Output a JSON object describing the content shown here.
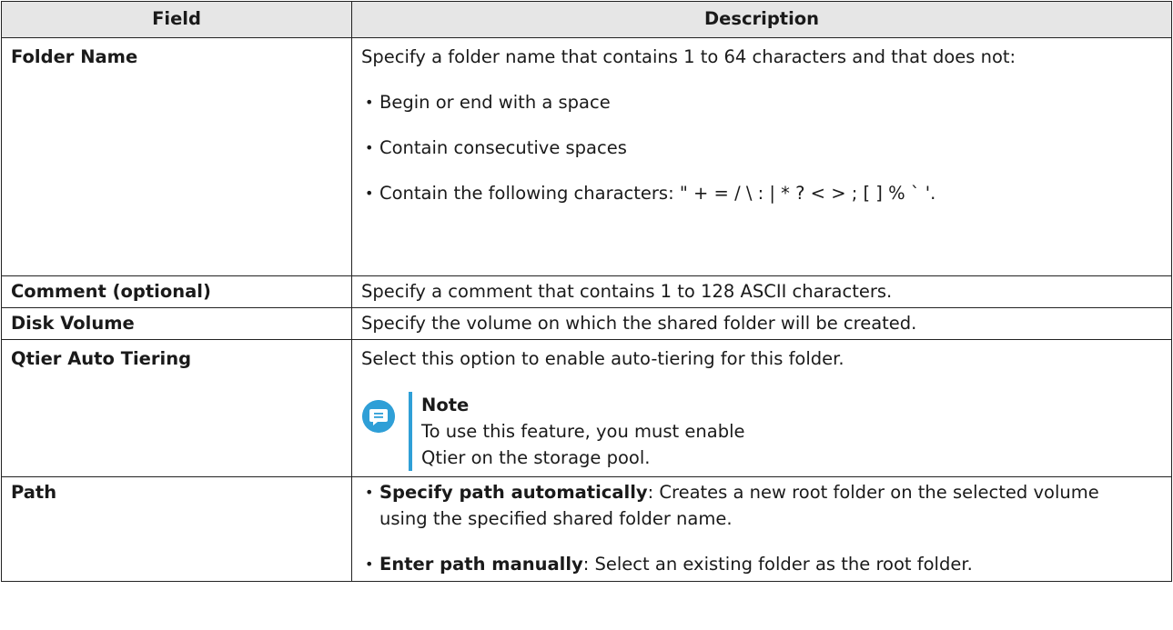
{
  "header": {
    "field": "Field",
    "description": "Description"
  },
  "rows": {
    "folder_name": {
      "field": "Folder Name",
      "intro": "Specify a folder name that contains 1 to 64 characters and that does not:",
      "bullets": [
        "Begin or end with a space",
        "Contain consecutive spaces",
        "Contain the following characters: \" + = / \\ : | * ? < > ; [ ] % ` '."
      ]
    },
    "comment": {
      "field": "Comment (optional)",
      "description": "Specify a comment that contains 1 to 128 ASCII characters."
    },
    "disk_volume": {
      "field": "Disk Volume",
      "description": "Specify the volume on which the shared folder will be created."
    },
    "qtier": {
      "field": "Qtier Auto Tiering",
      "description": "Select this option to enable auto-tiering for this folder.",
      "note_title": "Note",
      "note_body": "To use this feature, you must enable Qtier on the storage pool.",
      "note_icon": "note-icon",
      "note_color": "#2f9fd7"
    },
    "path": {
      "field": "Path",
      "items": [
        {
          "label": "Specify path automatically",
          "text": ": Creates a new root folder on the selected volume using the specified shared folder name."
        },
        {
          "label": "Enter path manually",
          "text": ": Select an existing folder as the root folder."
        }
      ]
    }
  }
}
